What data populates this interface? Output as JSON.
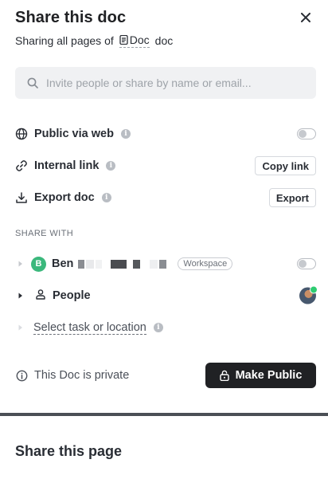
{
  "header": {
    "title": "Share this doc",
    "subtitle_prefix": "Sharing all pages of",
    "doc_name": "Doc",
    "subtitle_suffix": "doc"
  },
  "search": {
    "placeholder": "Invite people or share by name or email..."
  },
  "options": {
    "public_web": {
      "label": "Public via web",
      "enabled": false
    },
    "internal_link": {
      "label": "Internal link",
      "button": "Copy link"
    },
    "export": {
      "label": "Export doc",
      "button": "Export"
    }
  },
  "share_with": {
    "heading": "SHARE WITH",
    "workspace": {
      "avatar_letter": "B",
      "name": "Ben",
      "badge": "Workspace",
      "enabled": false
    },
    "people": {
      "label": "People"
    },
    "select": {
      "label": "Select task or location"
    }
  },
  "footer": {
    "privacy_text": "This Doc is private",
    "make_public": "Make Public"
  },
  "page_section": {
    "title": "Share this page"
  },
  "colors": {
    "accent_dark": "#202124",
    "workspace_avatar": "#3bb87c",
    "online_status": "#2ecc71"
  }
}
